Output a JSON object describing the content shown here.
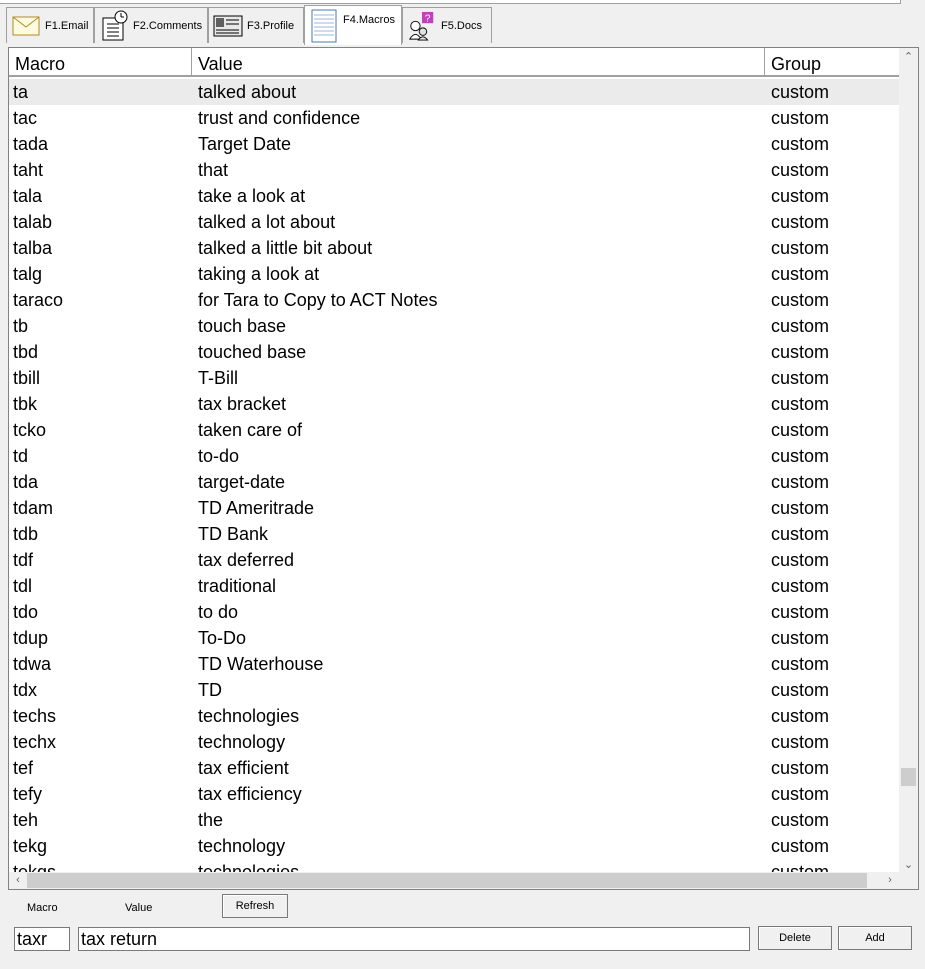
{
  "tabs": [
    {
      "label": "F1.Email",
      "icon": "envelope-icon"
    },
    {
      "label": "F2.Comments",
      "icon": "notebook-clock-icon"
    },
    {
      "label": "F3.Profile",
      "icon": "profile-card-icon"
    },
    {
      "label": "F4.Macros",
      "icon": "notepad-icon"
    },
    {
      "label": "F5.Docs",
      "icon": "help-docs-icon"
    }
  ],
  "grid": {
    "columns": [
      "Macro",
      "Value",
      "Group"
    ],
    "rows": [
      [
        "ta",
        "talked about",
        "custom"
      ],
      [
        "tac",
        "trust and confidence",
        "custom"
      ],
      [
        "tada",
        "Target Date",
        "custom"
      ],
      [
        "taht",
        "that",
        "custom"
      ],
      [
        "tala",
        "take a look at",
        "custom"
      ],
      [
        "talab",
        "talked a lot about",
        "custom"
      ],
      [
        "talba",
        "talked a little bit about",
        "custom"
      ],
      [
        "talg",
        "taking a look at",
        "custom"
      ],
      [
        "taraco",
        "for Tara to Copy to ACT Notes",
        "custom"
      ],
      [
        "tb",
        "touch base",
        "custom"
      ],
      [
        "tbd",
        "touched base",
        "custom"
      ],
      [
        "tbill",
        "T-Bill",
        "custom"
      ],
      [
        "tbk",
        "tax bracket",
        "custom"
      ],
      [
        "tcko",
        "taken care of",
        "custom"
      ],
      [
        "td",
        "to-do",
        "custom"
      ],
      [
        "tda",
        "target-date",
        "custom"
      ],
      [
        "tdam",
        "TD Ameritrade",
        "custom"
      ],
      [
        "tdb",
        "TD Bank",
        "custom"
      ],
      [
        "tdf",
        "tax deferred",
        "custom"
      ],
      [
        "tdl",
        "traditional",
        "custom"
      ],
      [
        "tdo",
        "to do",
        "custom"
      ],
      [
        "tdup",
        "To-Do",
        "custom"
      ],
      [
        "tdwa",
        "TD Waterhouse",
        "custom"
      ],
      [
        "tdx",
        "TD",
        "custom"
      ],
      [
        "techs",
        "technologies",
        "custom"
      ],
      [
        "techx",
        "technology",
        "custom"
      ],
      [
        "tef",
        "tax efficient",
        "custom"
      ],
      [
        "tefy",
        "tax efficiency",
        "custom"
      ],
      [
        "teh",
        "the",
        "custom"
      ],
      [
        "tekg",
        "technology",
        "custom"
      ],
      [
        "tekgs",
        "technologies",
        "custom"
      ]
    ]
  },
  "form": {
    "macro_label": "Macro",
    "value_label": "Value",
    "refresh_label": "Refresh",
    "macro_value": "taxr",
    "value_value": "tax return",
    "delete_label": "Delete",
    "add_label": "Add"
  }
}
